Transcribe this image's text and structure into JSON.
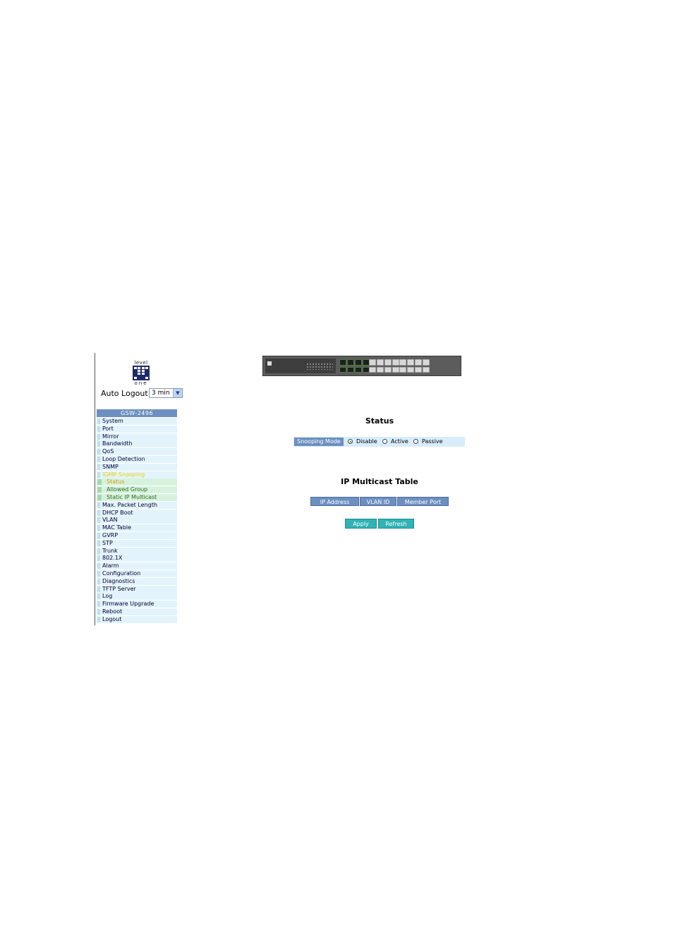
{
  "logo": {
    "top_text": "level",
    "bottom_text": "one"
  },
  "auto_logout": {
    "label": "Auto Logout",
    "value": "3 min"
  },
  "menu": {
    "header": "GSW-2496",
    "items": [
      {
        "label": "System",
        "type": "item"
      },
      {
        "label": "Port",
        "type": "item"
      },
      {
        "label": "Mirror",
        "type": "item"
      },
      {
        "label": "Bandwidth",
        "type": "item"
      },
      {
        "label": "QoS",
        "type": "item"
      },
      {
        "label": "Loop Detection",
        "type": "item"
      },
      {
        "label": "SNMP",
        "type": "item"
      },
      {
        "label": "IGMP Snooping",
        "type": "selected"
      },
      {
        "label": "Status",
        "type": "sub-active"
      },
      {
        "label": "Allowed Group",
        "type": "sub"
      },
      {
        "label": "Static IP Multicast",
        "type": "sub"
      },
      {
        "label": "Max. Packet Length",
        "type": "item"
      },
      {
        "label": "DHCP Boot",
        "type": "item"
      },
      {
        "label": "VLAN",
        "type": "item"
      },
      {
        "label": "MAC Table",
        "type": "item"
      },
      {
        "label": "GVRP",
        "type": "item"
      },
      {
        "label": "STP",
        "type": "item"
      },
      {
        "label": "Trunk",
        "type": "item"
      },
      {
        "label": "802.1X",
        "type": "item"
      },
      {
        "label": "Alarm",
        "type": "item"
      },
      {
        "label": "Configuration",
        "type": "item"
      },
      {
        "label": "Diagnostics",
        "type": "item"
      },
      {
        "label": "TFTP Server",
        "type": "item"
      },
      {
        "label": "Log",
        "type": "item"
      },
      {
        "label": "Firmware Upgrade",
        "type": "item"
      },
      {
        "label": "Reboot",
        "type": "item"
      },
      {
        "label": "Logout",
        "type": "item"
      }
    ]
  },
  "status": {
    "title": "Status",
    "snooping_mode_label": "Snooping Mode",
    "options": [
      "Disable",
      "Active",
      "Passive"
    ],
    "selected": "Disable"
  },
  "multicast_table": {
    "title": "IP Multicast Table",
    "columns": [
      "IP Address",
      "VLAN ID",
      "Member Port"
    ]
  },
  "buttons": {
    "apply": "Apply",
    "refresh": "Refresh"
  },
  "colors": {
    "menu_header": "#6c8fc0",
    "menu_item_bg": "#e3f3fb",
    "submenu_bg": "#d6f2dd",
    "selected_text": "#e8d400",
    "button_bg": "#30b3b5"
  }
}
